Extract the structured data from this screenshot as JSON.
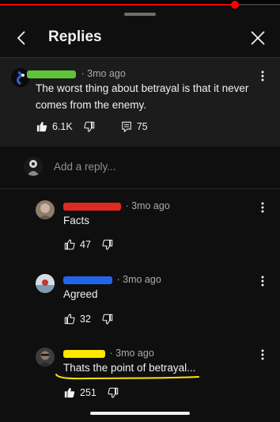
{
  "video": {
    "progress": 0.84
  },
  "header": {
    "title": "Replies"
  },
  "parent_comment": {
    "time": "3mo ago",
    "text": "The worst thing about betrayal is that it never comes from the enemy.",
    "likes": "6.1K",
    "replies": "75"
  },
  "add_reply": {
    "placeholder": "Add a reply..."
  },
  "replies": [
    {
      "time": "3mo ago",
      "text": "Facts",
      "likes": "47"
    },
    {
      "time": "3mo ago",
      "text": "Agreed",
      "likes": "32"
    },
    {
      "time": "3mo ago",
      "text": "Thats the point of betrayal...",
      "likes": "251"
    }
  ],
  "colors": {
    "background": "#0f0f0f",
    "parent_background": "#1c1c1c",
    "progress": "#ff0000",
    "redaction_green": "#5fc33a",
    "redaction_red": "#e12a1f",
    "redaction_blue": "#2266e8",
    "redaction_yellow": "#ffe600"
  },
  "icons": {
    "back": "chevron-left-icon",
    "close": "close-icon",
    "like": "thumbs-up-icon",
    "dislike": "thumbs-down-icon",
    "replies": "comment-icon",
    "more": "more-vertical-icon"
  }
}
